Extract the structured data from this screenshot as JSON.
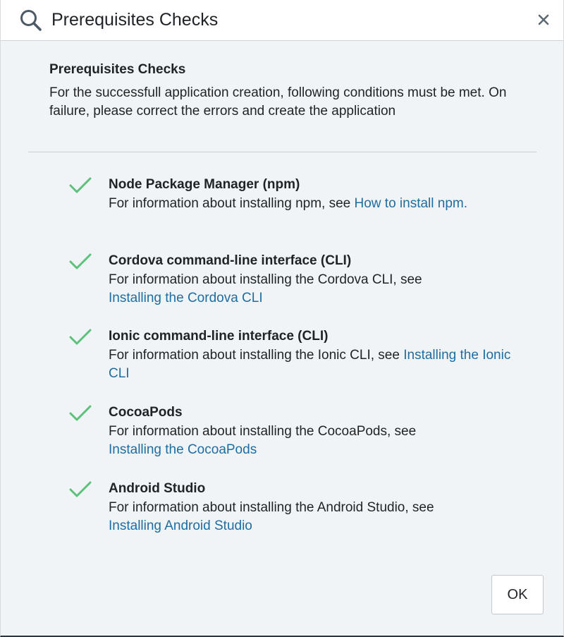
{
  "titlebar": {
    "title": "Prerequisites Checks",
    "icon": "search-icon",
    "close_icon": "close-icon"
  },
  "main": {
    "heading": "Prerequisites Checks",
    "intro": "For the successfull application creation, following conditions must be met. On failure, please correct the errors and create the application"
  },
  "checks": [
    {
      "title": "Node Package Manager (npm)",
      "desc_prefix": "For information about installing npm, see ",
      "link_text": "How to install npm.",
      "status": "passed"
    },
    {
      "title": "Cordova command-line interface (CLI)",
      "desc_prefix": "For information about installing the Cordova CLI, see ",
      "link_text": "Installing the Cordova CLI",
      "status": "passed"
    },
    {
      "title": "Ionic command-line interface (CLI)",
      "desc_prefix": "For information about installing the Ionic CLI, see ",
      "link_text": "Installing the Ionic CLI",
      "status": "passed"
    },
    {
      "title": "CocoaPods",
      "desc_prefix": "For information about installing the CocoaPods, see ",
      "link_text": "Installing the CocoaPods",
      "status": "passed"
    },
    {
      "title": "Android Studio",
      "desc_prefix": "For information about installing the Android Studio, see ",
      "link_text": "Installing Android Studio",
      "status": "passed"
    }
  ],
  "footer": {
    "ok_label": "OK"
  },
  "colors": {
    "check": "#5cc17a",
    "link": "#1e6da1",
    "background": "#f1f4f6"
  }
}
